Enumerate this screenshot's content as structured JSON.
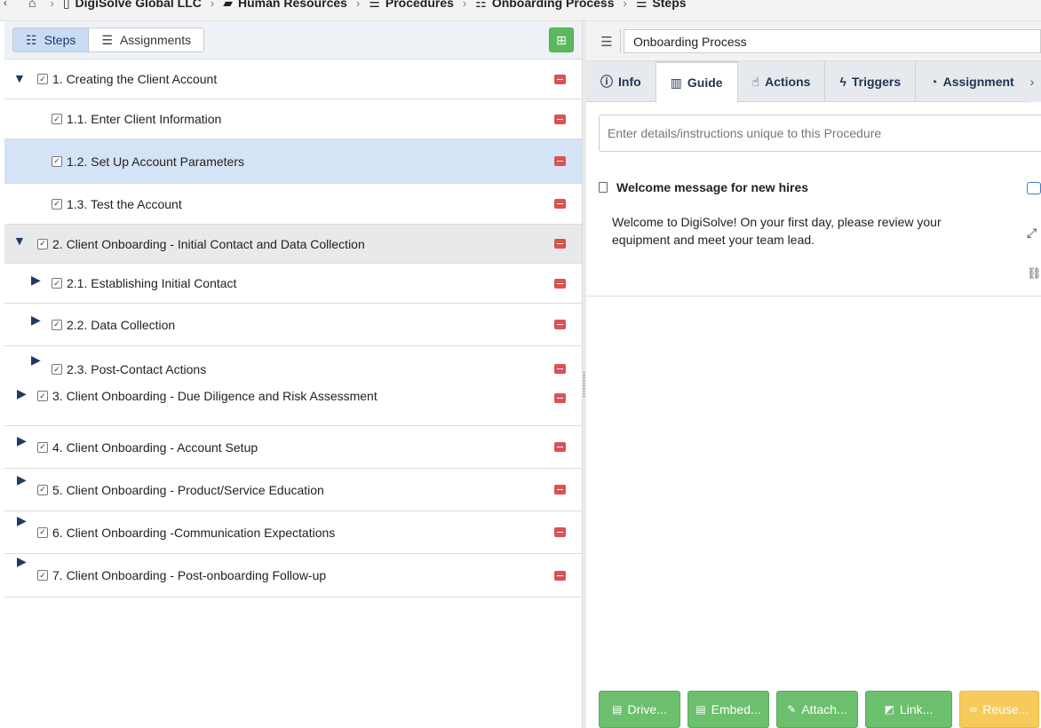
{
  "breadcrumb": [
    {
      "icon": "home-icon",
      "label": ""
    },
    {
      "icon": "building-icon",
      "label": "DigiSolve Global LLC"
    },
    {
      "icon": "book-icon",
      "label": "Human Resources"
    },
    {
      "icon": "list-icon",
      "label": "Procedures"
    },
    {
      "icon": "tasks-icon",
      "label": "Onboarding Process"
    },
    {
      "icon": "list-icon",
      "label": "Steps"
    }
  ],
  "left_toolbar": {
    "steps_label": "Steps",
    "assignments_label": "Assignments"
  },
  "steps": [
    {
      "label": "1.  Creating the Client Account"
    },
    {
      "label": "1.1.  Enter Client Information"
    },
    {
      "label": "1.2.  Set Up Account Parameters"
    },
    {
      "label": "1.3.  Test the Account"
    },
    {
      "label": "2.  Client Onboarding - Initial Contact and Data Collection"
    },
    {
      "label": "2.1.  Establishing Initial Contact"
    },
    {
      "label": "2.2.  Data Collection"
    },
    {
      "label": "2.3.  Post-Contact Actions"
    },
    {
      "label": "3.  Client Onboarding - Due Diligence and Risk Assessment"
    },
    {
      "label": "4.  Client Onboarding - Account Setup"
    },
    {
      "label": "5.  Client Onboarding - Product/Service Education"
    },
    {
      "label": "6.  Client Onboarding -Communication Expectations"
    },
    {
      "label": "7.  Client Onboarding - Post-onboarding Follow-up"
    }
  ],
  "procedure": {
    "name": "Onboarding Process"
  },
  "tabs": [
    {
      "label": "Info",
      "icon": "info-icon"
    },
    {
      "label": "Guide",
      "icon": "map-icon"
    },
    {
      "label": "Actions",
      "icon": "pointer-icon"
    },
    {
      "label": "Triggers",
      "icon": "bolt-icon"
    },
    {
      "label": "Assignment",
      "icon": "pie-chart-icon"
    }
  ],
  "guide": {
    "description_placeholder": "Enter details/instructions unique to this Procedure",
    "title": "Welcome message for new hires",
    "body": "Welcome to DigiSolve! On your first day, please review your equipment and meet your team lead."
  },
  "bottom_buttons": [
    {
      "label": "Drive...",
      "color": "#6cbf6c"
    },
    {
      "label": "Embed...",
      "color": "#6cbf6c"
    },
    {
      "label": "Attach...",
      "color": "#6cbf6c"
    },
    {
      "label": "Link...",
      "color": "#6cbf6c"
    },
    {
      "label": "Reuse...",
      "color": "#f6cb5b"
    }
  ]
}
